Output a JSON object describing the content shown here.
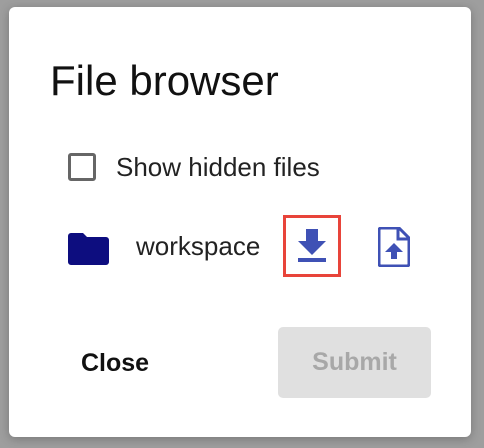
{
  "dialog": {
    "title": "File browser",
    "show_hidden": {
      "label": "Show hidden files",
      "checked": false
    },
    "entries": [
      {
        "name": "workspace",
        "type": "folder",
        "icon": "folder-icon",
        "actions": [
          {
            "icon": "download-icon",
            "highlighted": true
          },
          {
            "icon": "upload-file-icon",
            "highlighted": false
          }
        ]
      }
    ],
    "buttons": {
      "close_label": "Close",
      "submit_label": "Submit",
      "submit_enabled": false
    }
  },
  "colors": {
    "accent": "#3f51b5",
    "folder": "#0d0d7f",
    "highlight": "#e8443a",
    "disabled_bg": "#e0e0e0",
    "disabled_text": "#a8a8a8"
  }
}
